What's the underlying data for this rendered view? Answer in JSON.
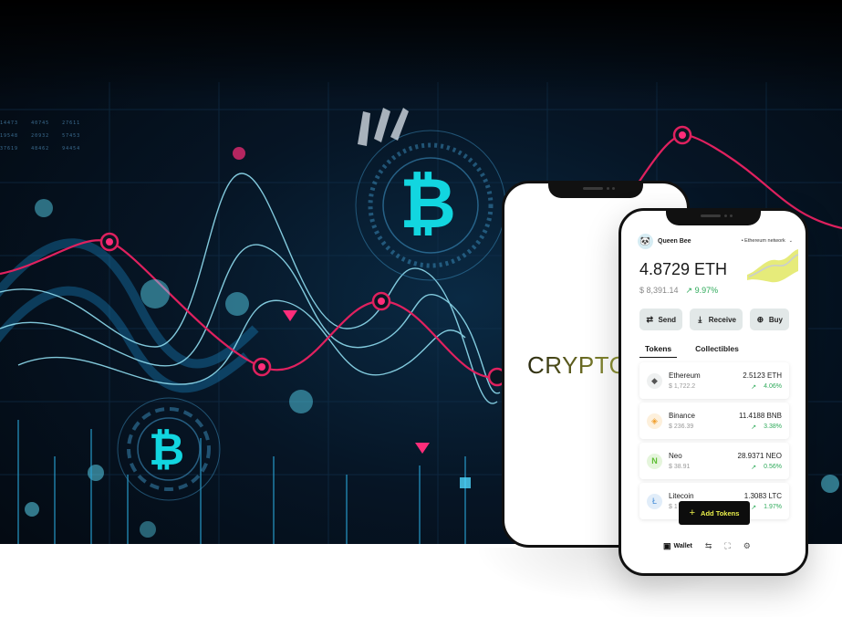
{
  "hero": {
    "glyph": "₿",
    "ticker_rows": [
      [
        "14473",
        "40745",
        "27611"
      ],
      [
        "19548",
        "20932",
        "57453"
      ],
      [
        "37619",
        "48462",
        "94454"
      ]
    ]
  },
  "back_phone": {
    "brand_text": "CRYPTO"
  },
  "wallet": {
    "user_name": "Queen Bee",
    "avatar_glyph": "🐼",
    "network_label": "• Ethereum network",
    "network_chevron": "⌄",
    "balance": "4.8729 ETH",
    "balance_fiat": "$ 8,391.14",
    "balance_change": "↗ 9.97%",
    "actions": [
      {
        "label": "Send",
        "icon": "⇄"
      },
      {
        "label": "Receive",
        "icon": "⤓"
      },
      {
        "label": "Buy",
        "icon": "⊕"
      }
    ],
    "tabs": [
      "Tokens",
      "Collectibles"
    ],
    "tokens": [
      {
        "name": "Ethereum",
        "fiat": "$ 1,722.2",
        "amount": "2.5123 ETH",
        "change": "4.06%",
        "icon": "◆",
        "color": "#555555"
      },
      {
        "name": "Binance",
        "fiat": "$ 236.39",
        "amount": "11.4188 BNB",
        "change": "3.38%",
        "icon": "◈",
        "color": "#f0a030"
      },
      {
        "name": "Neo",
        "fiat": "$ 38.91",
        "amount": "28.9371 NEO",
        "change": "0.56%",
        "icon": "N",
        "color": "#5fbf34"
      },
      {
        "name": "Litecoin",
        "fiat": "$ 1",
        "amount": "1.3083 LTC",
        "change": "1.97%",
        "icon": "Ł",
        "color": "#4a8fd8"
      }
    ],
    "change_arrow": "↗",
    "add_tokens_label": "Add Tokens",
    "add_tokens_icon": "+",
    "nav": {
      "wallet_label": "Wallet",
      "wallet_icon": "▣",
      "swap_icon": "⇆",
      "scan_icon": "⛶",
      "settings_icon": "⚙"
    }
  },
  "colors": {
    "accent_pink": "#ff2d7a",
    "accent_cyan": "#12d6e0",
    "positive": "#2eaa5a",
    "button_text": "#e9ee4a"
  }
}
